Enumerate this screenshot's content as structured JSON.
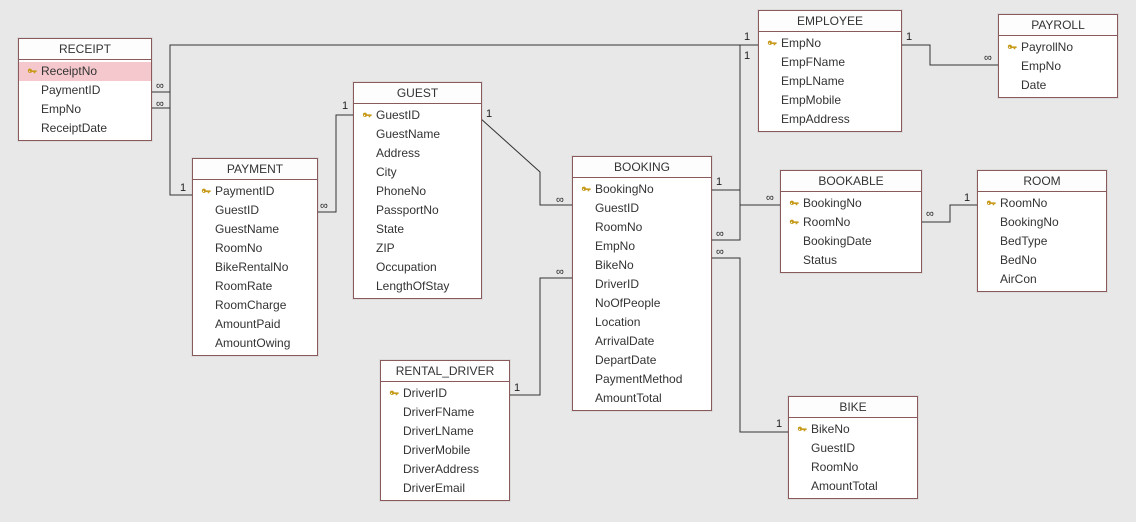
{
  "tables": {
    "receipt": {
      "title": "RECEIPT",
      "fields": [
        {
          "name": "ReceiptNo",
          "pk": true,
          "selected": true
        },
        {
          "name": "PaymentID",
          "pk": false
        },
        {
          "name": "EmpNo",
          "pk": false
        },
        {
          "name": "ReceiptDate",
          "pk": false
        }
      ]
    },
    "payment": {
      "title": "PAYMENT",
      "fields": [
        {
          "name": "PaymentID",
          "pk": true
        },
        {
          "name": "GuestID",
          "pk": false
        },
        {
          "name": "GuestName",
          "pk": false
        },
        {
          "name": "RoomNo",
          "pk": false
        },
        {
          "name": "BikeRentalNo",
          "pk": false
        },
        {
          "name": "RoomRate",
          "pk": false
        },
        {
          "name": "RoomCharge",
          "pk": false
        },
        {
          "name": "AmountPaid",
          "pk": false
        },
        {
          "name": "AmountOwing",
          "pk": false
        }
      ]
    },
    "guest": {
      "title": "GUEST",
      "fields": [
        {
          "name": "GuestID",
          "pk": true
        },
        {
          "name": "GuestName",
          "pk": false
        },
        {
          "name": "Address",
          "pk": false
        },
        {
          "name": "City",
          "pk": false
        },
        {
          "name": "PhoneNo",
          "pk": false
        },
        {
          "name": "PassportNo",
          "pk": false
        },
        {
          "name": "State",
          "pk": false
        },
        {
          "name": "ZIP",
          "pk": false
        },
        {
          "name": "Occupation",
          "pk": false
        },
        {
          "name": "LengthOfStay",
          "pk": false
        }
      ]
    },
    "booking": {
      "title": "BOOKING",
      "fields": [
        {
          "name": "BookingNo",
          "pk": true
        },
        {
          "name": "GuestID",
          "pk": false
        },
        {
          "name": "RoomNo",
          "pk": false
        },
        {
          "name": "EmpNo",
          "pk": false
        },
        {
          "name": "BikeNo",
          "pk": false
        },
        {
          "name": "DriverID",
          "pk": false
        },
        {
          "name": "NoOfPeople",
          "pk": false
        },
        {
          "name": "Location",
          "pk": false
        },
        {
          "name": "ArrivalDate",
          "pk": false
        },
        {
          "name": "DepartDate",
          "pk": false
        },
        {
          "name": "PaymentMethod",
          "pk": false
        },
        {
          "name": "AmountTotal",
          "pk": false
        }
      ]
    },
    "employee": {
      "title": "EMPLOYEE",
      "fields": [
        {
          "name": "EmpNo",
          "pk": true
        },
        {
          "name": "EmpFName",
          "pk": false
        },
        {
          "name": "EmpLName",
          "pk": false
        },
        {
          "name": "EmpMobile",
          "pk": false
        },
        {
          "name": "EmpAddress",
          "pk": false
        }
      ]
    },
    "payroll": {
      "title": "PAYROLL",
      "fields": [
        {
          "name": "PayrollNo",
          "pk": true
        },
        {
          "name": "EmpNo",
          "pk": false
        },
        {
          "name": "Date",
          "pk": false
        }
      ]
    },
    "bookable": {
      "title": "BOOKABLE",
      "fields": [
        {
          "name": "BookingNo",
          "pk": true
        },
        {
          "name": "RoomNo",
          "pk": true
        },
        {
          "name": "BookingDate",
          "pk": false
        },
        {
          "name": "Status",
          "pk": false
        }
      ]
    },
    "room": {
      "title": "ROOM",
      "fields": [
        {
          "name": "RoomNo",
          "pk": true
        },
        {
          "name": "BookingNo",
          "pk": false
        },
        {
          "name": "BedType",
          "pk": false
        },
        {
          "name": "BedNo",
          "pk": false
        },
        {
          "name": "AirCon",
          "pk": false
        }
      ]
    },
    "rental_driver": {
      "title": "RENTAL_DRIVER",
      "fields": [
        {
          "name": "DriverID",
          "pk": true
        },
        {
          "name": "DriverFName",
          "pk": false
        },
        {
          "name": "DriverLName",
          "pk": false
        },
        {
          "name": "DriverMobile",
          "pk": false
        },
        {
          "name": "DriverAddress",
          "pk": false
        },
        {
          "name": "DriverEmail",
          "pk": false
        }
      ]
    },
    "bike": {
      "title": "BIKE",
      "fields": [
        {
          "name": "BikeNo",
          "pk": true
        },
        {
          "name": "GuestID",
          "pk": false
        },
        {
          "name": "RoomNo",
          "pk": false
        },
        {
          "name": "AmountTotal",
          "pk": false
        }
      ]
    }
  },
  "labels": {
    "one": "1",
    "many": "∞"
  }
}
